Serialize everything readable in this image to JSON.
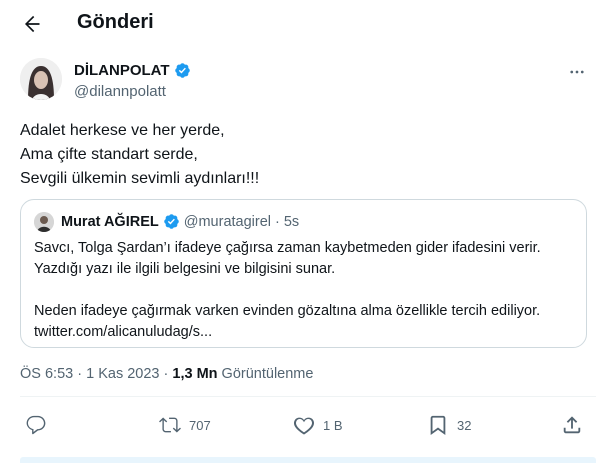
{
  "header": {
    "title": "Gönderi"
  },
  "tweet": {
    "author_name": "DİLANPOLAT",
    "author_handle": "@dilannpolatt",
    "text_lines": [
      "Adalet herkese ve her yerde,",
      "Ama çifte standart serde,",
      "Sevgili ülkemin sevimli aydınları!!!"
    ],
    "time": "ÖS 6:53",
    "date": "1 Kas 2023",
    "views_count": "1,3 Mn",
    "views_label": "Görüntülenme",
    "sep": "·"
  },
  "quote": {
    "author_name": "Murat AĞIREL",
    "author_handle": "@muratagirel",
    "age": "5s",
    "sep": "·",
    "lines": [
      "Savcı, Tolga Şardan’ı ifadeye çağırsa zaman kaybetmeden gider ifadesini verir.",
      "Yazdığı yazı ile ilgili belgesini ve bilgisini sunar.",
      "Neden ifadeye çağırmak varken evinden gözaltına alma özellikle tercih ediliyor.",
      "twitter.com/alicanuludag/s..."
    ]
  },
  "actions": {
    "reply_count": "",
    "retweet_count": "707",
    "like_count": "1 B",
    "bookmark_count": "32"
  },
  "icons": [
    "back-arrow-icon",
    "verified-badge-icon",
    "more-icon",
    "reply-icon",
    "retweet-icon",
    "like-icon",
    "bookmark-icon",
    "share-icon"
  ],
  "colors": {
    "verified": "#1d9bf0",
    "muted": "#536471",
    "text": "#0f1419",
    "border": "#cfd9de"
  }
}
